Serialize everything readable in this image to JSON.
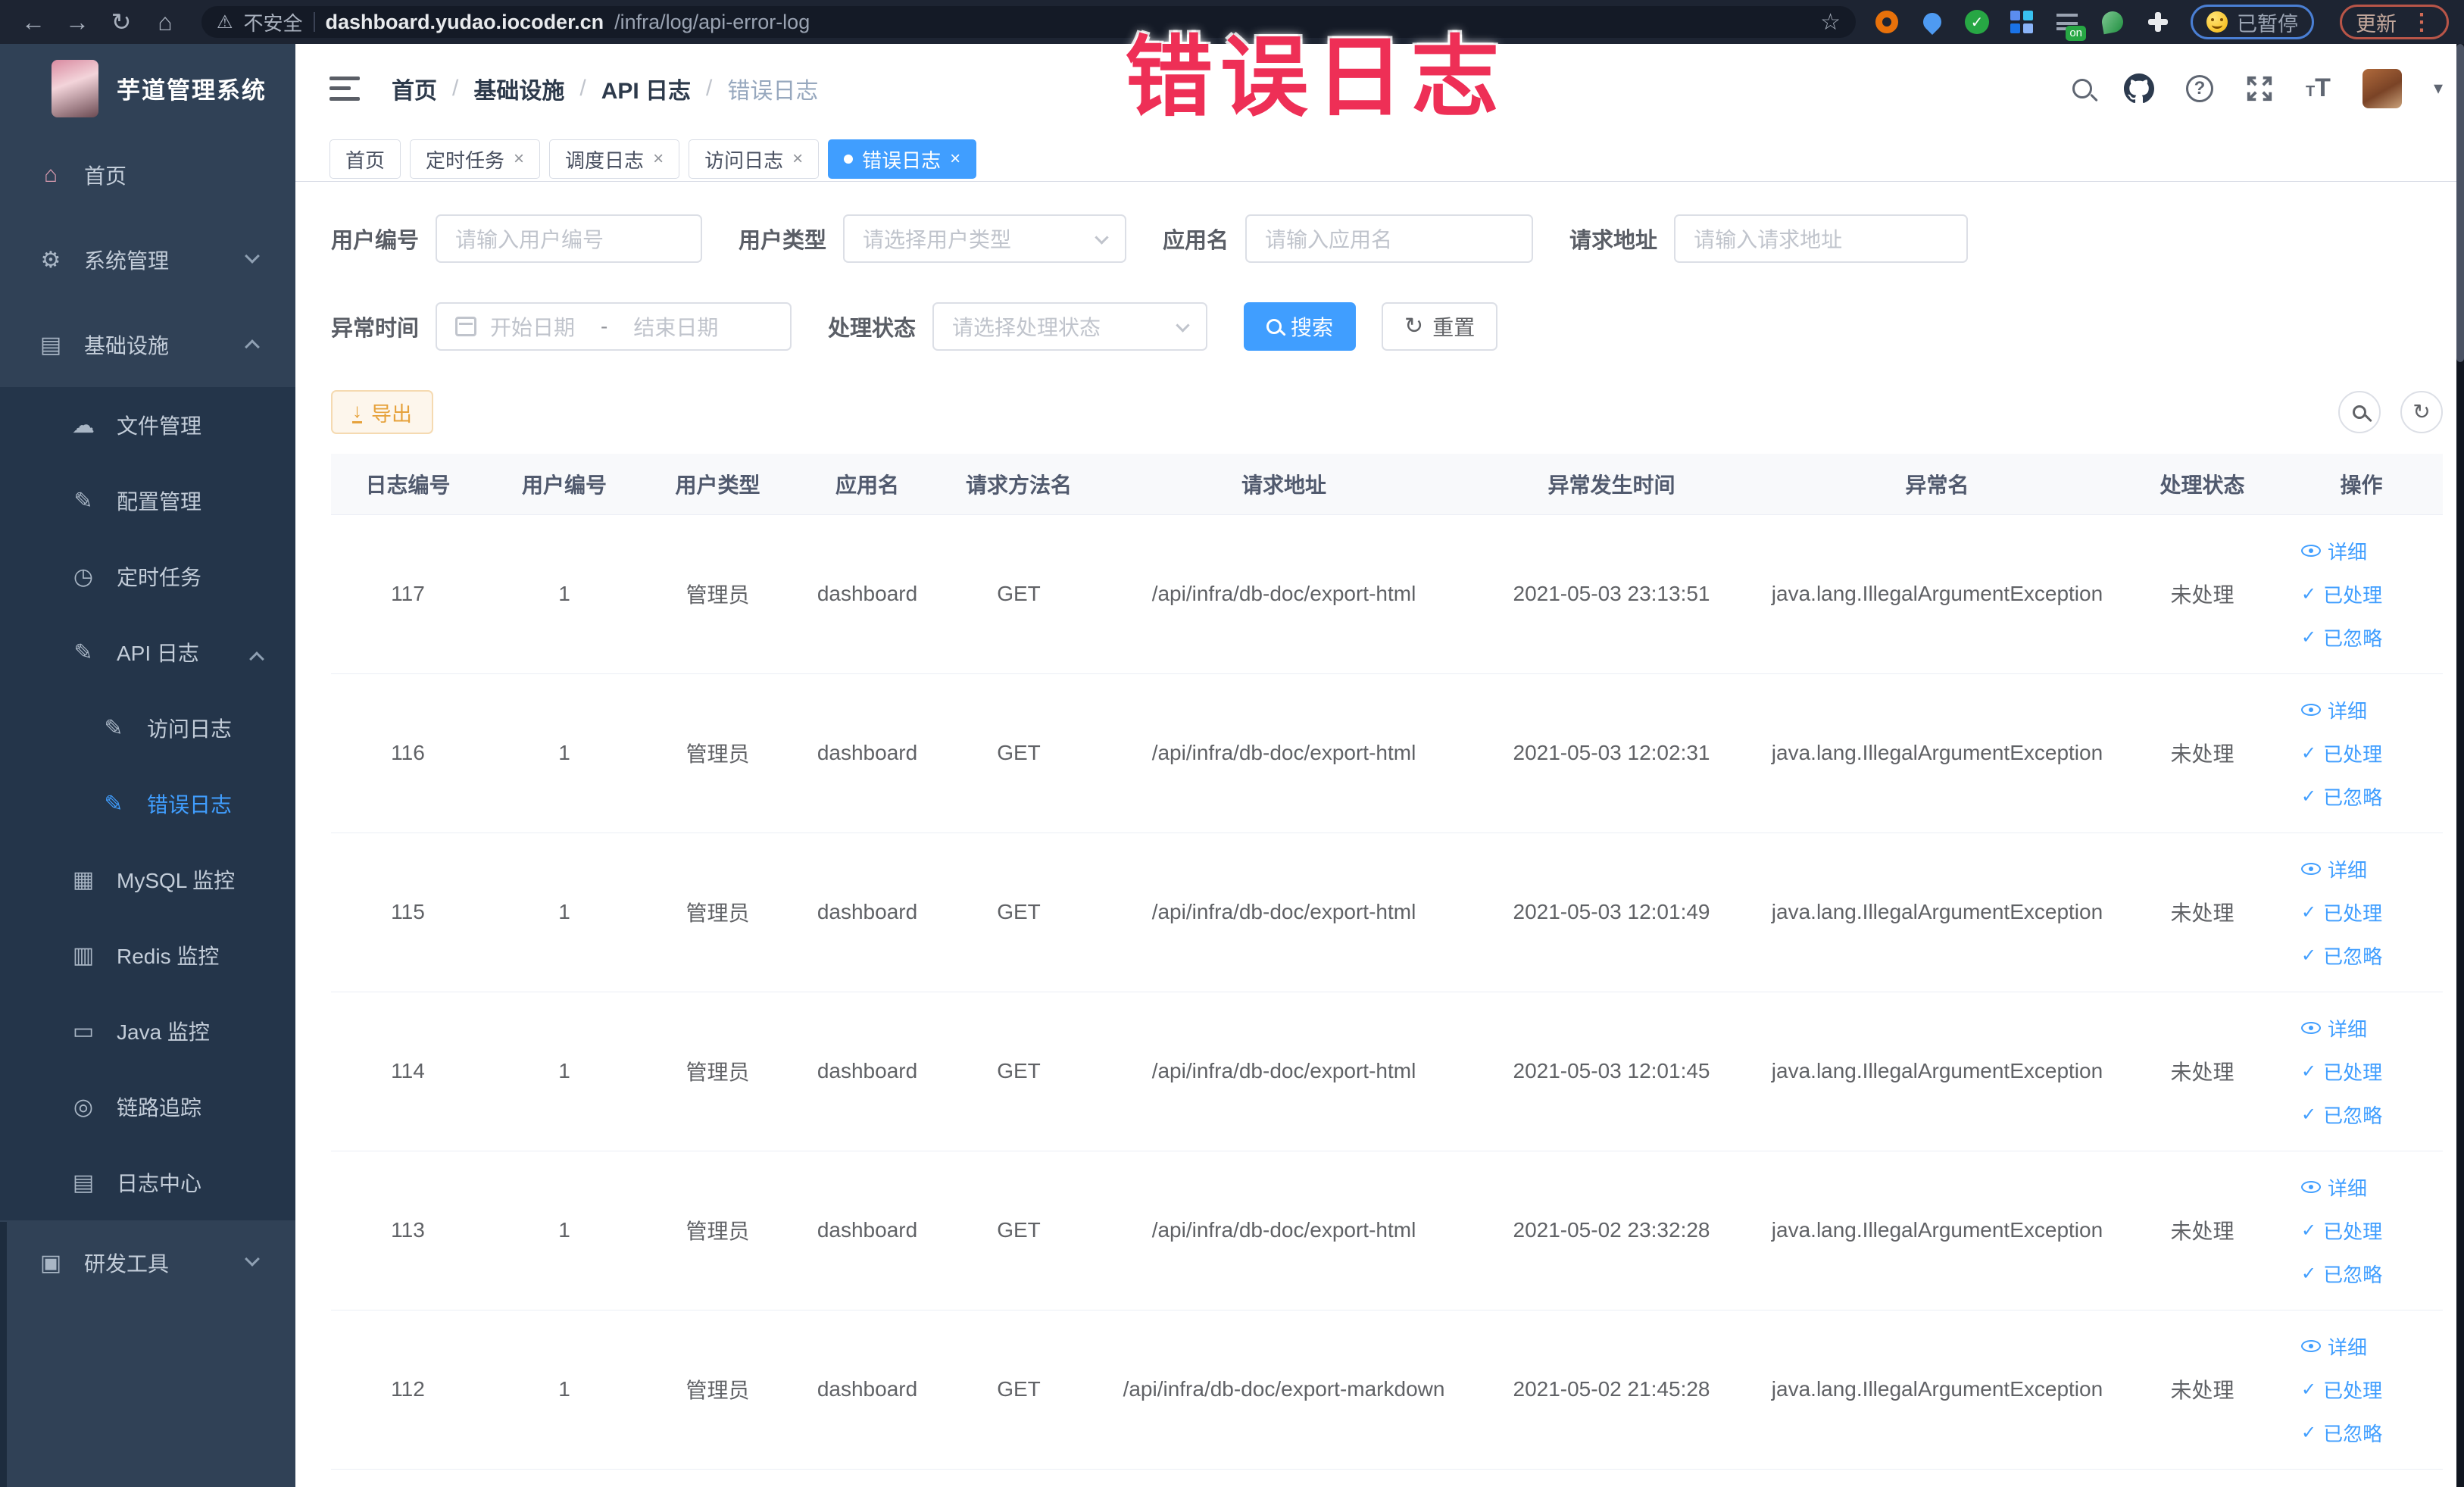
{
  "icons": {
    "back": "←",
    "forward": "→",
    "reload": "↻",
    "home": "⌂",
    "warning": "⚠",
    "star": "☆",
    "close": "×",
    "caret": "▾",
    "check": "✓",
    "refresh": "↻",
    "download": "↓",
    "dots": "⋮",
    "question": "?"
  },
  "browser": {
    "security_label": "不安全",
    "url_host": "dashboard.yudao.iocoder.cn",
    "url_path": "/infra/log/api-error-log",
    "ext_on_badge": "on",
    "paused_label": "已暂停",
    "update_label": "更新"
  },
  "annotation": {
    "text": "错误日志",
    "color": "#ee2f56"
  },
  "sidebar": {
    "title": "芋道管理系统",
    "items": [
      {
        "label": "首页",
        "icon": "⌂"
      },
      {
        "label": "系统管理",
        "icon": "⚙"
      },
      {
        "label": "基础设施",
        "icon": "▤"
      },
      {
        "label": "文件管理",
        "icon": "☁"
      },
      {
        "label": "配置管理",
        "icon": "✎"
      },
      {
        "label": "定时任务",
        "icon": "◷"
      },
      {
        "label": "API 日志",
        "icon": "✎"
      },
      {
        "label": "访问日志",
        "icon": "✎"
      },
      {
        "label": "错误日志",
        "icon": "✎"
      },
      {
        "label": "MySQL 监控",
        "icon": "▦"
      },
      {
        "label": "Redis 监控",
        "icon": "▥"
      },
      {
        "label": "Java 监控",
        "icon": "▭"
      },
      {
        "label": "链路追踪",
        "icon": "◎"
      },
      {
        "label": "日志中心",
        "icon": "▤"
      },
      {
        "label": "研发工具",
        "icon": "▣"
      }
    ]
  },
  "header": {
    "breadcrumb": [
      "首页",
      "基础设施",
      "API 日志",
      "错误日志"
    ],
    "separator": "/"
  },
  "tabs": [
    {
      "label": "首页"
    },
    {
      "label": "定时任务"
    },
    {
      "label": "调度日志"
    },
    {
      "label": "访问日志"
    },
    {
      "label": "错误日志"
    }
  ],
  "filters": {
    "user_id": {
      "label": "用户编号",
      "placeholder": "请输入用户编号"
    },
    "user_type": {
      "label": "用户类型",
      "placeholder": "请选择用户类型"
    },
    "app_name": {
      "label": "应用名",
      "placeholder": "请输入应用名"
    },
    "request_url": {
      "label": "请求地址",
      "placeholder": "请输入请求地址"
    },
    "exception_time": {
      "label": "异常时间",
      "start_placeholder": "开始日期",
      "separator": "-",
      "end_placeholder": "结束日期"
    },
    "process_status": {
      "label": "处理状态",
      "placeholder": "请选择处理状态"
    },
    "search_label": "搜索",
    "reset_label": "重置"
  },
  "toolbar": {
    "export_label": "导出"
  },
  "table": {
    "columns": [
      "日志编号",
      "用户编号",
      "用户类型",
      "应用名",
      "请求方法名",
      "请求地址",
      "异常发生时间",
      "异常名",
      "处理状态",
      "操作"
    ],
    "actions": {
      "detail": "详细",
      "processed": "已处理",
      "ignored": "已忽略"
    },
    "rows": [
      {
        "id": "117",
        "user_id": "1",
        "user_type": "管理员",
        "app": "dashboard",
        "method": "GET",
        "url": "/api/infra/db-doc/export-html",
        "time": "2021-05-03 23:13:51",
        "exception": "java.lang.IllegalArgumentException",
        "status": "未处理"
      },
      {
        "id": "116",
        "user_id": "1",
        "user_type": "管理员",
        "app": "dashboard",
        "method": "GET",
        "url": "/api/infra/db-doc/export-html",
        "time": "2021-05-03 12:02:31",
        "exception": "java.lang.IllegalArgumentException",
        "status": "未处理"
      },
      {
        "id": "115",
        "user_id": "1",
        "user_type": "管理员",
        "app": "dashboard",
        "method": "GET",
        "url": "/api/infra/db-doc/export-html",
        "time": "2021-05-03 12:01:49",
        "exception": "java.lang.IllegalArgumentException",
        "status": "未处理"
      },
      {
        "id": "114",
        "user_id": "1",
        "user_type": "管理员",
        "app": "dashboard",
        "method": "GET",
        "url": "/api/infra/db-doc/export-html",
        "time": "2021-05-03 12:01:45",
        "exception": "java.lang.IllegalArgumentException",
        "status": "未处理"
      },
      {
        "id": "113",
        "user_id": "1",
        "user_type": "管理员",
        "app": "dashboard",
        "method": "GET",
        "url": "/api/infra/db-doc/export-html",
        "time": "2021-05-02 23:32:28",
        "exception": "java.lang.IllegalArgumentException",
        "status": "未处理"
      },
      {
        "id": "112",
        "user_id": "1",
        "user_type": "管理员",
        "app": "dashboard",
        "method": "GET",
        "url": "/api/infra/db-doc/export-markdown",
        "time": "2021-05-02 21:45:28",
        "exception": "java.lang.IllegalArgumentException",
        "status": "未处理"
      }
    ]
  },
  "colors": {
    "accent": "#409eff",
    "warning": "#e6a23c",
    "annotation_red": "#ee2f56",
    "sidebar_bg": "#304156",
    "submenu_bg": "#24354a"
  }
}
